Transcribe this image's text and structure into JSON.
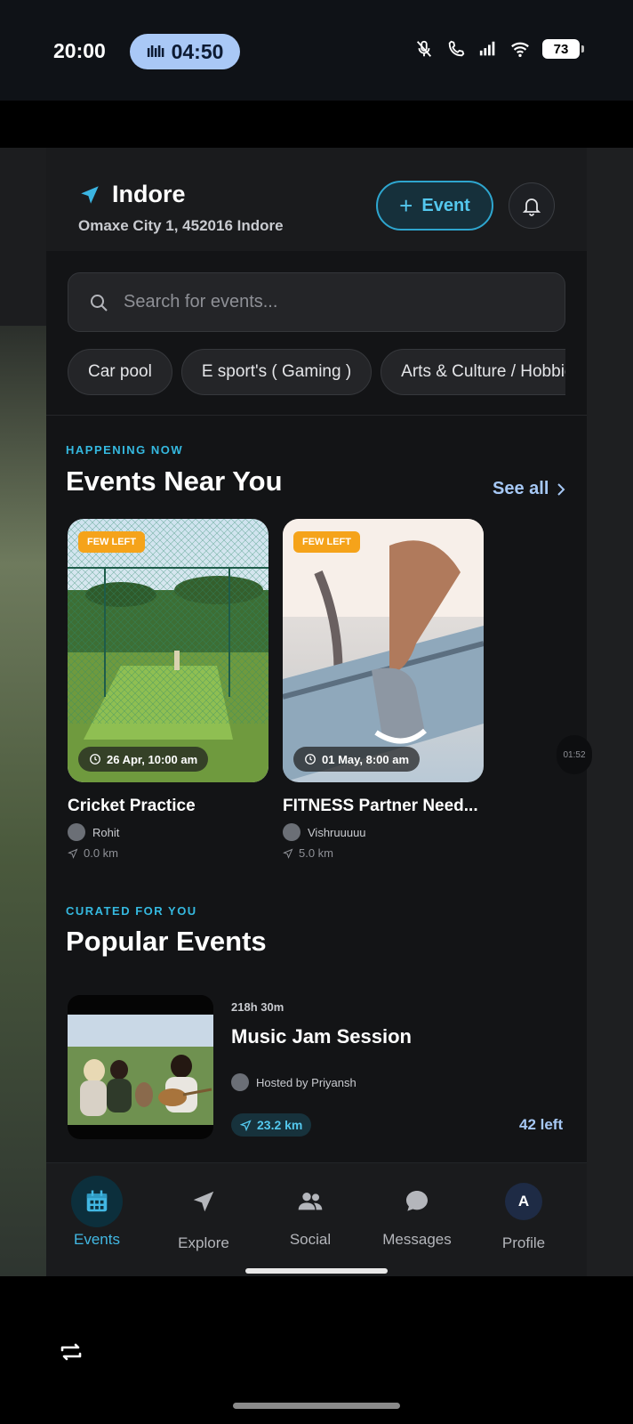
{
  "status_bar": {
    "time": "20:00",
    "call_timer": "04:50",
    "battery": "73"
  },
  "header": {
    "city": "Indore",
    "address": "Omaxe City 1, 452016 Indore",
    "add_event_label": "Event"
  },
  "search": {
    "placeholder": "Search for events..."
  },
  "categories": [
    "Car pool",
    "E sport's ( Gaming )",
    "Arts & Culture / Hobbies"
  ],
  "nearby": {
    "kicker": "HAPPENING NOW",
    "title": "Events Near You",
    "see_all": "See all",
    "peek_time": "01:52",
    "events": [
      {
        "badge": "FEW LEFT",
        "datetime": "26 Apr, 10:00 am",
        "title": "Cricket Practice",
        "host": "Rohit",
        "distance": "0.0 km"
      },
      {
        "badge": "FEW LEFT",
        "datetime": "01 May, 8:00 am",
        "title": "FITNESS Partner Need...",
        "host": "Vishruuuuu",
        "distance": "5.0 km"
      }
    ]
  },
  "popular": {
    "kicker": "CURATED FOR YOU",
    "title": "Popular Events",
    "events": [
      {
        "duration": "218h 30m",
        "title": "Music Jam Session",
        "host": "Hosted by Priyansh",
        "distance": "23.2 km",
        "spots_left": "42 left"
      }
    ]
  },
  "bottom_nav": {
    "items": [
      {
        "label": "Events",
        "icon": "calendar-icon",
        "active": true
      },
      {
        "label": "Explore",
        "icon": "navigation-arrow-icon",
        "active": false
      },
      {
        "label": "Social",
        "icon": "people-icon",
        "active": false
      },
      {
        "label": "Messages",
        "icon": "chat-bubble-icon",
        "active": false
      },
      {
        "label": "Profile",
        "icon": "avatar",
        "active": false
      }
    ],
    "profile_initial": "A"
  },
  "colors": {
    "accent": "#42b8e3",
    "link": "#a6c8f5",
    "badge": "#f5a31a",
    "background": "#131416"
  }
}
